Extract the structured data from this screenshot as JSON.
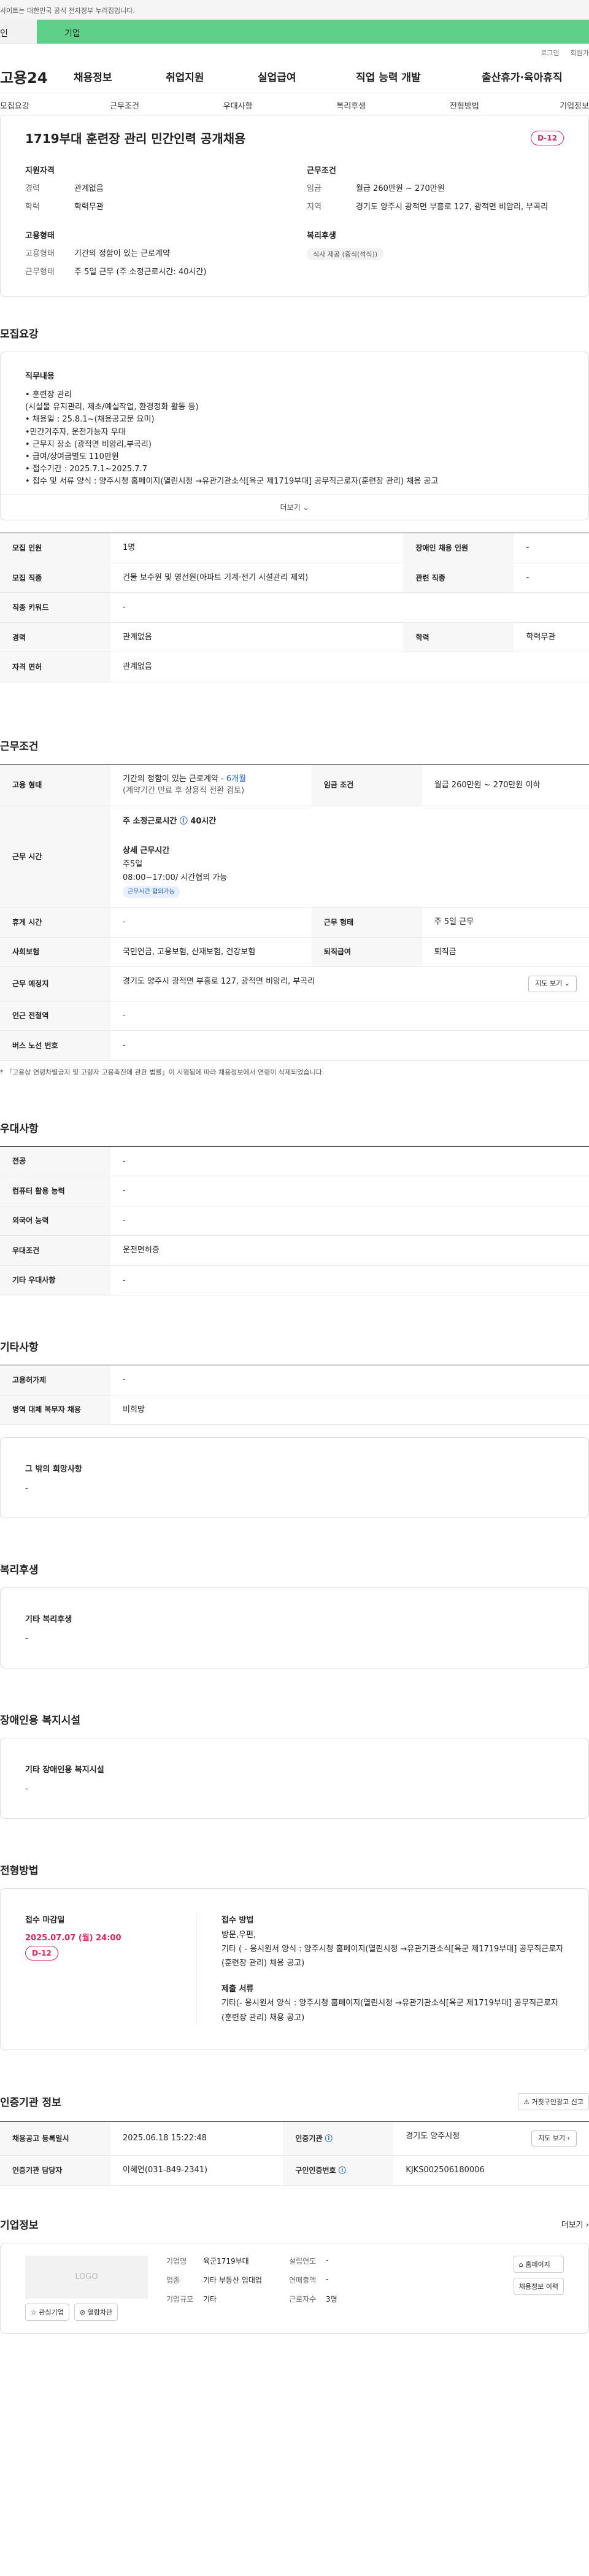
{
  "gov_bar": "사이트는 대한민국 공식 전자정부 누리집입니다.",
  "top_tabs": [
    "인",
    "기업"
  ],
  "util": [
    "로그인",
    "회원가"
  ],
  "logo": "고용24",
  "nav": [
    "채용정보",
    "취업지원",
    "실업급여",
    "직업 능력 개발",
    "출산휴가·육아휴직"
  ],
  "subnav": [
    "모집요강",
    "근무조건",
    "우대사항",
    "복리후생",
    "전형방법",
    "기업정보"
  ],
  "job": {
    "title": "1719부대 훈련장 관리 민간인력 공개채용",
    "dday": "D-12",
    "qual_title": "지원자격",
    "qual": [
      {
        "k": "경력",
        "v": "관계없음"
      },
      {
        "k": "학력",
        "v": "학력무관"
      }
    ],
    "cond_title": "근무조건",
    "cond": [
      {
        "k": "임금",
        "v": "월급 260만원 ~ 270만원"
      },
      {
        "k": "지역",
        "v": "경기도 양주시 광적면 부흥로 127, 광적면 비암리, 부곡리"
      }
    ],
    "emp_title": "고용형태",
    "emp": [
      {
        "k": "고용형태",
        "v": "기간의 정함이 있는 근로계약"
      },
      {
        "k": "근무형태",
        "v": "주 5일 근무 (주 소정근로시간: 40시간)"
      }
    ],
    "welfare_title": "복리후생",
    "welfare_pill": "식사 제공 (중식(석식))"
  },
  "recruit": {
    "title": "모집요강",
    "duty_h": "직무내용",
    "duty_lines": [
      "• 훈련장 관리",
      "(시설물 유지관리, 제초/예실작업, 환경정화 활동 등)",
      "• 채용일 : 25.8.1~(채용공고문 요미)",
      "•민간거주자, 운전가능자 우대",
      "• 근무지 장소 (광적면 비암리,부곡리)",
      "• 급여/상여금별도 110만원",
      "• 접수기간 : 2025.7.1~2025.7.7",
      "• 접수 및 서류 양식 : 양주시청 홈페이지(열린시청 →유관기관소식[육군 제1719부대] 공무직근로자(훈련장 관리) 채용 공고"
    ],
    "more": "더보기",
    "rows": [
      {
        "l1": "모집 인원",
        "v1": "1명",
        "l2": "장애인 채용 인원",
        "v2": "-"
      },
      {
        "l1": "모집 직종",
        "v1": "건물 보수원 및 영선원(아파트 기계·전기 시설관리 제외)",
        "l2": "관련 직종",
        "v2": "-"
      },
      {
        "l1": "직종 키워드",
        "v1": "-",
        "l2": "",
        "v2": ""
      },
      {
        "l1": "경력",
        "v1": "관계없음",
        "l2": "학력",
        "v2": "학력무관"
      },
      {
        "l1": "자격 면허",
        "v1": "관계없음",
        "l2": "",
        "v2": ""
      }
    ]
  },
  "work": {
    "title": "근무조건",
    "emp_type_label": "고용 형태",
    "emp_type_v": "기간의 정함이 있는 근로계약 - ",
    "emp_type_period": "6개월",
    "emp_type_note": "(계약기간 만료 후 상용직 전환 검토)",
    "wage_label": "임금 조건",
    "wage_v": "월급 260만원 ~ 270만원 이하",
    "hours_label": "근무 시간",
    "hours_week": "주 소정근로시간 ",
    "hours_week_v": "40시간",
    "hours_detail_h": "상세 근무시간",
    "hours_days": "주5일",
    "hours_time": "08:00~17:00/ 시간협의 가능",
    "hours_tag": "근무시간 협의가능",
    "rest_label": "휴게 시간",
    "rest_v": "-",
    "form_label": "근무 형태",
    "form_v": "주 5일 근무",
    "ins_label": "사회보험",
    "ins_v": "국민연금, 고용보험, 산재보험, 건강보험",
    "ret_label": "퇴직급여",
    "ret_v": "퇴직금",
    "place_label": "근무 예정지",
    "place_v": "경기도 양주시 광적면 부흥로 127, 광적면 비암리, 부곡리",
    "map_btn": "지도 보기",
    "station_label": "인근 전철역",
    "station_v": "-",
    "bus_label": "버스 노선 번호",
    "bus_v": "-",
    "note": "* 「고용상 연령차별금지 및 고령자 고용촉진에 관한 법률」이 시행됨에 따라 채용정보에서 연령이 삭제되었습니다."
  },
  "pref": {
    "title": "우대사항",
    "rows": [
      {
        "l": "전공",
        "v": "-"
      },
      {
        "l": "컴퓨터 활용 능력",
        "v": "-"
      },
      {
        "l": "외국어 능력",
        "v": "-"
      },
      {
        "l": "우대조건",
        "v": "운전면허증"
      },
      {
        "l": "기타 우대사항",
        "v": "-"
      }
    ]
  },
  "etc": {
    "title": "기타사항",
    "rows": [
      {
        "l": "고용허가제",
        "v": "-"
      },
      {
        "l": "병역 대체 복무자 채용",
        "v": "비희망"
      }
    ],
    "other_h": "그 밖의 희망사항",
    "other_v": "-"
  },
  "welfare": {
    "title": "복리후생",
    "h": "기타 복리후생",
    "v": "-"
  },
  "disabled": {
    "title": "장애인용 복지시설",
    "h": "기타 장애인용 복지시설",
    "v": "-"
  },
  "process": {
    "title": "전형방법",
    "deadline_h": "접수 마감일",
    "deadline_v": "2025.07.07 (월) 24:00",
    "dday": "D-12",
    "method_h": "접수 방법",
    "method_v": "방문,우편,",
    "method_etc": "기타 ( - 응시원서 양식 : 양주시청 홈페이지(열린시청 →유관기관소식[육군 제1719부대] 공무직근로자(훈련장 관리) 채용 공고)",
    "docs_h": "제출 서류",
    "docs_v": "기타(- 응시원서 양식 : 양주시청 홈페이지(열린시청 →유관기관소식[육군 제1719부대] 공무직근로자(훈련장 관리) 채용 공고)"
  },
  "cert": {
    "title": "인증기관 정보",
    "report_btn": "거짓구인광고 신고",
    "reg_l": "채용공고 등록일시",
    "reg_v": "2025.06.18 15:22:48",
    "inst_l": "인증기관",
    "inst_v": "경기도 양주시청",
    "manager_l": "인증기관 담당자",
    "manager_v": "이혜연(031-849-2341)",
    "num_l": "구인인증번호",
    "num_v": "KJKS002506180006",
    "map_btn": "지도 보기"
  },
  "company": {
    "title": "기업정보",
    "more": "더보기",
    "logo": "LOGO",
    "fav_btn": "관심기업",
    "review_btn": "열람차단",
    "name_l": "기업명",
    "name_v": "육군1719부대",
    "year_l": "설립연도",
    "year_v": "-",
    "ind_l": "업종",
    "ind_v": "기타 부동산 임대업",
    "sales_l": "연매출액",
    "sales_v": "-",
    "emp_l": "근로자수",
    "emp_v": "3명",
    "size_l": "기업규모",
    "size_v": "기타",
    "home_btn": "홈페이지",
    "jobs_btn": "채용정보 이력"
  }
}
